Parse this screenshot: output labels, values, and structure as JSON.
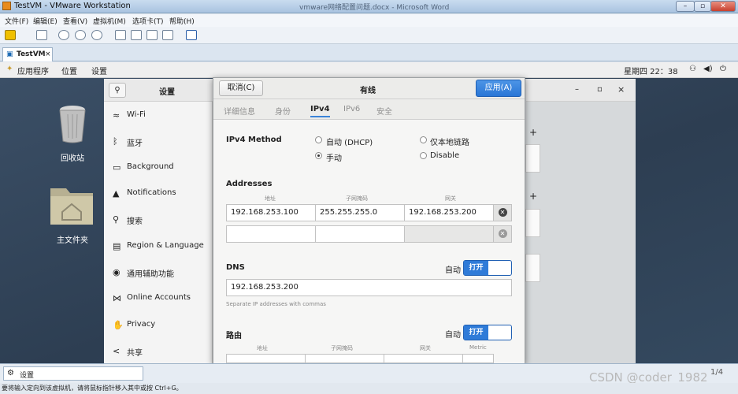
{
  "window": {
    "title": "TestVM - VMware Workstation",
    "bg_title": "vmware网络配置问题.docx - Microsoft Word"
  },
  "menu": [
    "文件(F)",
    "编辑(E)",
    "查看(V)",
    "虚拟机(M)",
    "选项卡(T)",
    "帮助(H)"
  ],
  "vm_tab": {
    "label": "TestVM",
    "close": "×"
  },
  "gnome_bar": {
    "apps": "应用程序",
    "places": "位置",
    "settings": "设置",
    "clock": "星期四 22：38"
  },
  "desktop": {
    "trash": "回收站",
    "home": "主文件夹"
  },
  "settings": {
    "title": "设置",
    "items": [
      {
        "icon": "wifi-icon",
        "label": "Wi-Fi"
      },
      {
        "icon": "bluetooth-icon",
        "label": "蓝牙"
      },
      {
        "icon": "background-icon",
        "label": "Background"
      },
      {
        "icon": "bell-icon",
        "label": "Notifications"
      },
      {
        "icon": "search-icon",
        "label": "搜索"
      },
      {
        "icon": "language-icon",
        "label": "Region & Language"
      },
      {
        "icon": "accessibility-icon",
        "label": "通用辅助功能"
      },
      {
        "icon": "online-accounts-icon",
        "label": "Online Accounts"
      },
      {
        "icon": "privacy-icon",
        "label": "Privacy"
      },
      {
        "icon": "share-icon",
        "label": "共享"
      }
    ],
    "win_buttons": [
      "–",
      "▫",
      "×"
    ]
  },
  "dialog": {
    "cancel": "取消(C)",
    "title": "有线",
    "apply": "应用(A)",
    "tabs": [
      "详细信息",
      "身份",
      "IPv4",
      "IPv6",
      "安全"
    ],
    "active_tab": "IPv4",
    "method_label": "IPv4 Method",
    "methods": [
      "自动 (DHCP)",
      "仅本地链路",
      "手动",
      "Disable"
    ],
    "selected_method": "手动",
    "addresses_label": "Addresses",
    "addr_cols": [
      "地址",
      "子网掩码",
      "网关"
    ],
    "addr_rows": [
      [
        "192.168.253.100",
        "255.255.255.0",
        "192.168.253.200"
      ],
      [
        "",
        "",
        ""
      ]
    ],
    "dns_label": "DNS",
    "auto_label": "自动",
    "switch_on": "打开",
    "dns_value": "192.168.253.200",
    "dns_hint": "Separate IP addresses with commas",
    "routes_label": "路由",
    "route_cols": [
      "地址",
      "子网掩码",
      "网关",
      "Metric"
    ]
  },
  "statusbar": {
    "item": "设置",
    "hint": "要将输入定向到该虚拟机，请将鼠标指针移入其中或按 Ctrl+G。",
    "page": "1/4",
    "watermark": "CSDN @coder_1982"
  }
}
